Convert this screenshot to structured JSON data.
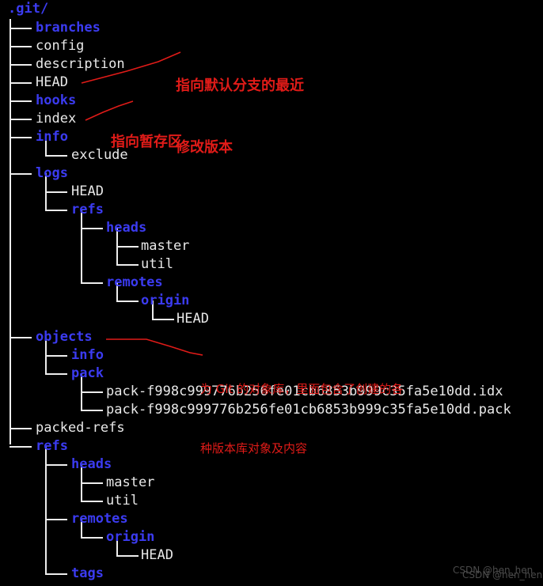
{
  "root": {
    "label": ".git/"
  },
  "colors": {
    "background": "#000000",
    "directory": "#3b3bf0",
    "file": "#e8e8e8",
    "tree_line": "#ededed",
    "annotation": "#e01b18",
    "watermark": "#4a4a4a"
  },
  "tree": {
    "rows": [
      {
        "label": "branches",
        "type": "dir",
        "depth": 1
      },
      {
        "label": "config",
        "type": "file",
        "depth": 1
      },
      {
        "label": "description",
        "type": "file",
        "depth": 1
      },
      {
        "label": "HEAD",
        "type": "file",
        "depth": 1
      },
      {
        "label": "hooks",
        "type": "dir",
        "depth": 1
      },
      {
        "label": "index",
        "type": "file",
        "depth": 1
      },
      {
        "label": "info",
        "type": "dir",
        "depth": 1
      },
      {
        "label": "exclude",
        "type": "file",
        "depth": 2
      },
      {
        "label": "logs",
        "type": "dir",
        "depth": 1
      },
      {
        "label": "HEAD",
        "type": "file",
        "depth": 2
      },
      {
        "label": "refs",
        "type": "dir",
        "depth": 2
      },
      {
        "label": "heads",
        "type": "dir",
        "depth": 3
      },
      {
        "label": "master",
        "type": "file",
        "depth": 4
      },
      {
        "label": "util",
        "type": "file",
        "depth": 4
      },
      {
        "label": "remotes",
        "type": "dir",
        "depth": 3
      },
      {
        "label": "origin",
        "type": "dir",
        "depth": 4
      },
      {
        "label": "HEAD",
        "type": "file",
        "depth": 5
      },
      {
        "label": "objects",
        "type": "dir",
        "depth": 1
      },
      {
        "label": "info",
        "type": "dir",
        "depth": 2
      },
      {
        "label": "pack",
        "type": "dir",
        "depth": 2
      },
      {
        "label": "pack-f998c999776b256fe01cb6853b999c35fa5e10dd.idx",
        "type": "file",
        "depth": 3
      },
      {
        "label": "pack-f998c999776b256fe01cb6853b999c35fa5e10dd.pack",
        "type": "file",
        "depth": 3
      },
      {
        "label": "packed-refs",
        "type": "file",
        "depth": 1
      },
      {
        "label": "refs",
        "type": "dir",
        "depth": 1
      },
      {
        "label": "heads",
        "type": "dir",
        "depth": 2
      },
      {
        "label": "master",
        "type": "file",
        "depth": 3
      },
      {
        "label": "util",
        "type": "file",
        "depth": 3
      },
      {
        "label": "remotes",
        "type": "dir",
        "depth": 2
      },
      {
        "label": "origin",
        "type": "dir",
        "depth": 3
      },
      {
        "label": "HEAD",
        "type": "file",
        "depth": 4
      },
      {
        "label": "tags",
        "type": "dir",
        "depth": 2
      }
    ]
  },
  "annotations": {
    "head_note": {
      "line1": "指向默认分支的最近",
      "line2": "修改版本",
      "target": "HEAD"
    },
    "index_note": {
      "line1": "指向暂存区",
      "target": "index"
    },
    "objects_note": {
      "line1": "为 Git 的对象库，里面包含了创建的各",
      "line2": "种版本库对象及内容",
      "target": "objects"
    }
  },
  "watermark": {
    "line1": "CSDN @hen_hen",
    "line2": "CSDN @hen_hen"
  }
}
